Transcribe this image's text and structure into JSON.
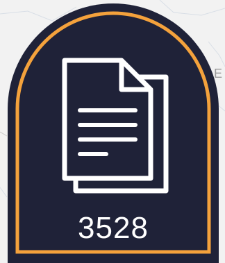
{
  "badge": {
    "icon": "documents-icon",
    "count": "3528"
  },
  "map": {
    "edge_label": "E"
  },
  "colors": {
    "badge_fill": "#1f2238",
    "badge_border": "#f4a23c",
    "icon_stroke": "#ffffff",
    "count_text": "#ffffff",
    "map_background": "#f2f2f2"
  }
}
